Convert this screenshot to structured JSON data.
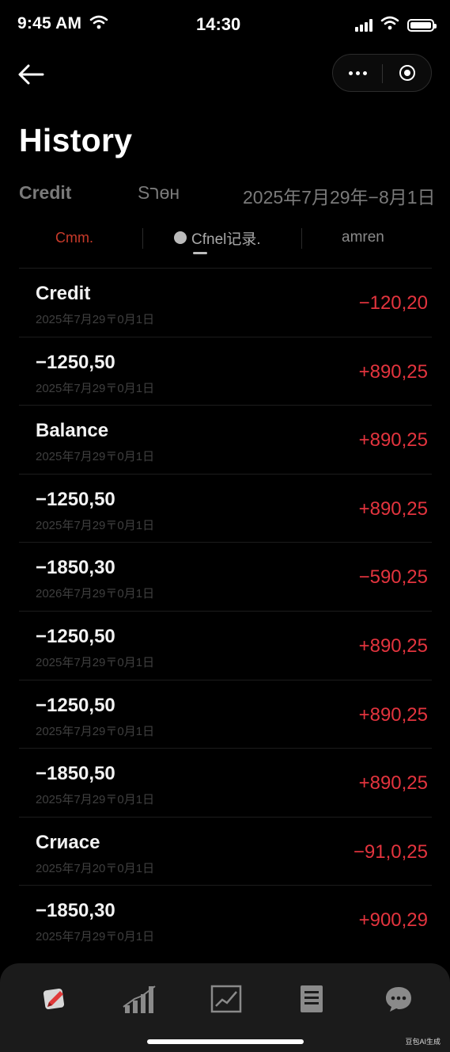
{
  "status_bar": {
    "time": "9:45 AM",
    "center_time": "14:30"
  },
  "header": {
    "title": "History"
  },
  "filters": {
    "type": "Credit",
    "mid": "Sרөн",
    "date_range": "2025年7月29年−8月1日"
  },
  "tabs": [
    {
      "label": "Cmm."
    },
    {
      "label": "Cfnel记录."
    },
    {
      "label": "amren"
    }
  ],
  "transactions": [
    {
      "title": "Credit",
      "date": "2025年7月29〒0月1日",
      "amount": "−120,20"
    },
    {
      "title": "−1250,50",
      "date": "2025年7月29〒0月1日",
      "amount": "+890,25"
    },
    {
      "title": "Balance",
      "date": "2025年7月29〒0月1日",
      "amount": "+890,25"
    },
    {
      "title": "−1250,50",
      "date": "2025年7月29〒0月1日",
      "amount": "+890,25"
    },
    {
      "title": "−1850,30",
      "date": "2026年7月29〒0月1日",
      "amount": "−590,25"
    },
    {
      "title": "−1250,50",
      "date": "2025年7月29〒0月1日",
      "amount": "+890,25"
    },
    {
      "title": "−1250,50",
      "date": "2025年7月29〒0月1日",
      "amount": "+890,25"
    },
    {
      "title": "−1850,50",
      "date": "2025年7月29〒0月1日",
      "amount": "+890,25"
    },
    {
      "title": "Crиace",
      "date": "2025年7月20〒0月1日",
      "amount": "−91,0,25"
    },
    {
      "title": "−1850,30",
      "date": "2025年7月29〒0月1日",
      "amount": "+900,29"
    }
  ],
  "bottom_nav": [
    {
      "icon": "pencil-icon"
    },
    {
      "icon": "bar-chart-icon"
    },
    {
      "icon": "line-chart-icon"
    },
    {
      "icon": "document-icon"
    },
    {
      "icon": "chat-bubble-icon"
    }
  ],
  "watermark": "豆包AI生成",
  "colors": {
    "background": "#000000",
    "amount_red": "#e3343e",
    "tab_active_red": "#c83a2a",
    "tabbar_bg": "#1b1b1b"
  }
}
